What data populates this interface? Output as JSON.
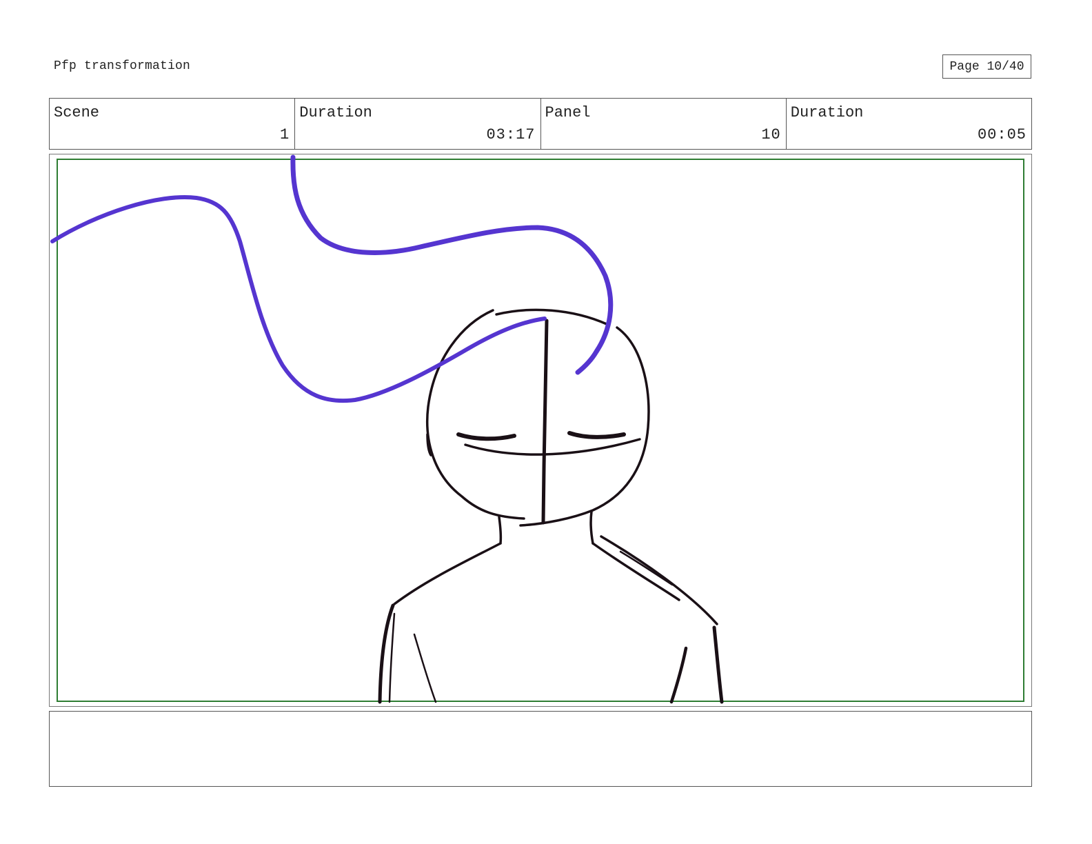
{
  "header": {
    "project_title": "Pfp transformation",
    "page_label": "Page",
    "page_number": "10/40"
  },
  "info": {
    "scene": {
      "label": "Scene",
      "value": "1"
    },
    "scene_duration": {
      "label": "Duration",
      "value": "03:17"
    },
    "panel": {
      "label": "Panel",
      "value": "10"
    },
    "panel_duration": {
      "label": "Duration",
      "value": "00:05"
    }
  },
  "panel": {
    "safe_frame_color": "#2e7d32",
    "sketch_ink_color": "#1a1016",
    "ribbon_color": "#5535d0"
  },
  "notes": {
    "text": ""
  }
}
